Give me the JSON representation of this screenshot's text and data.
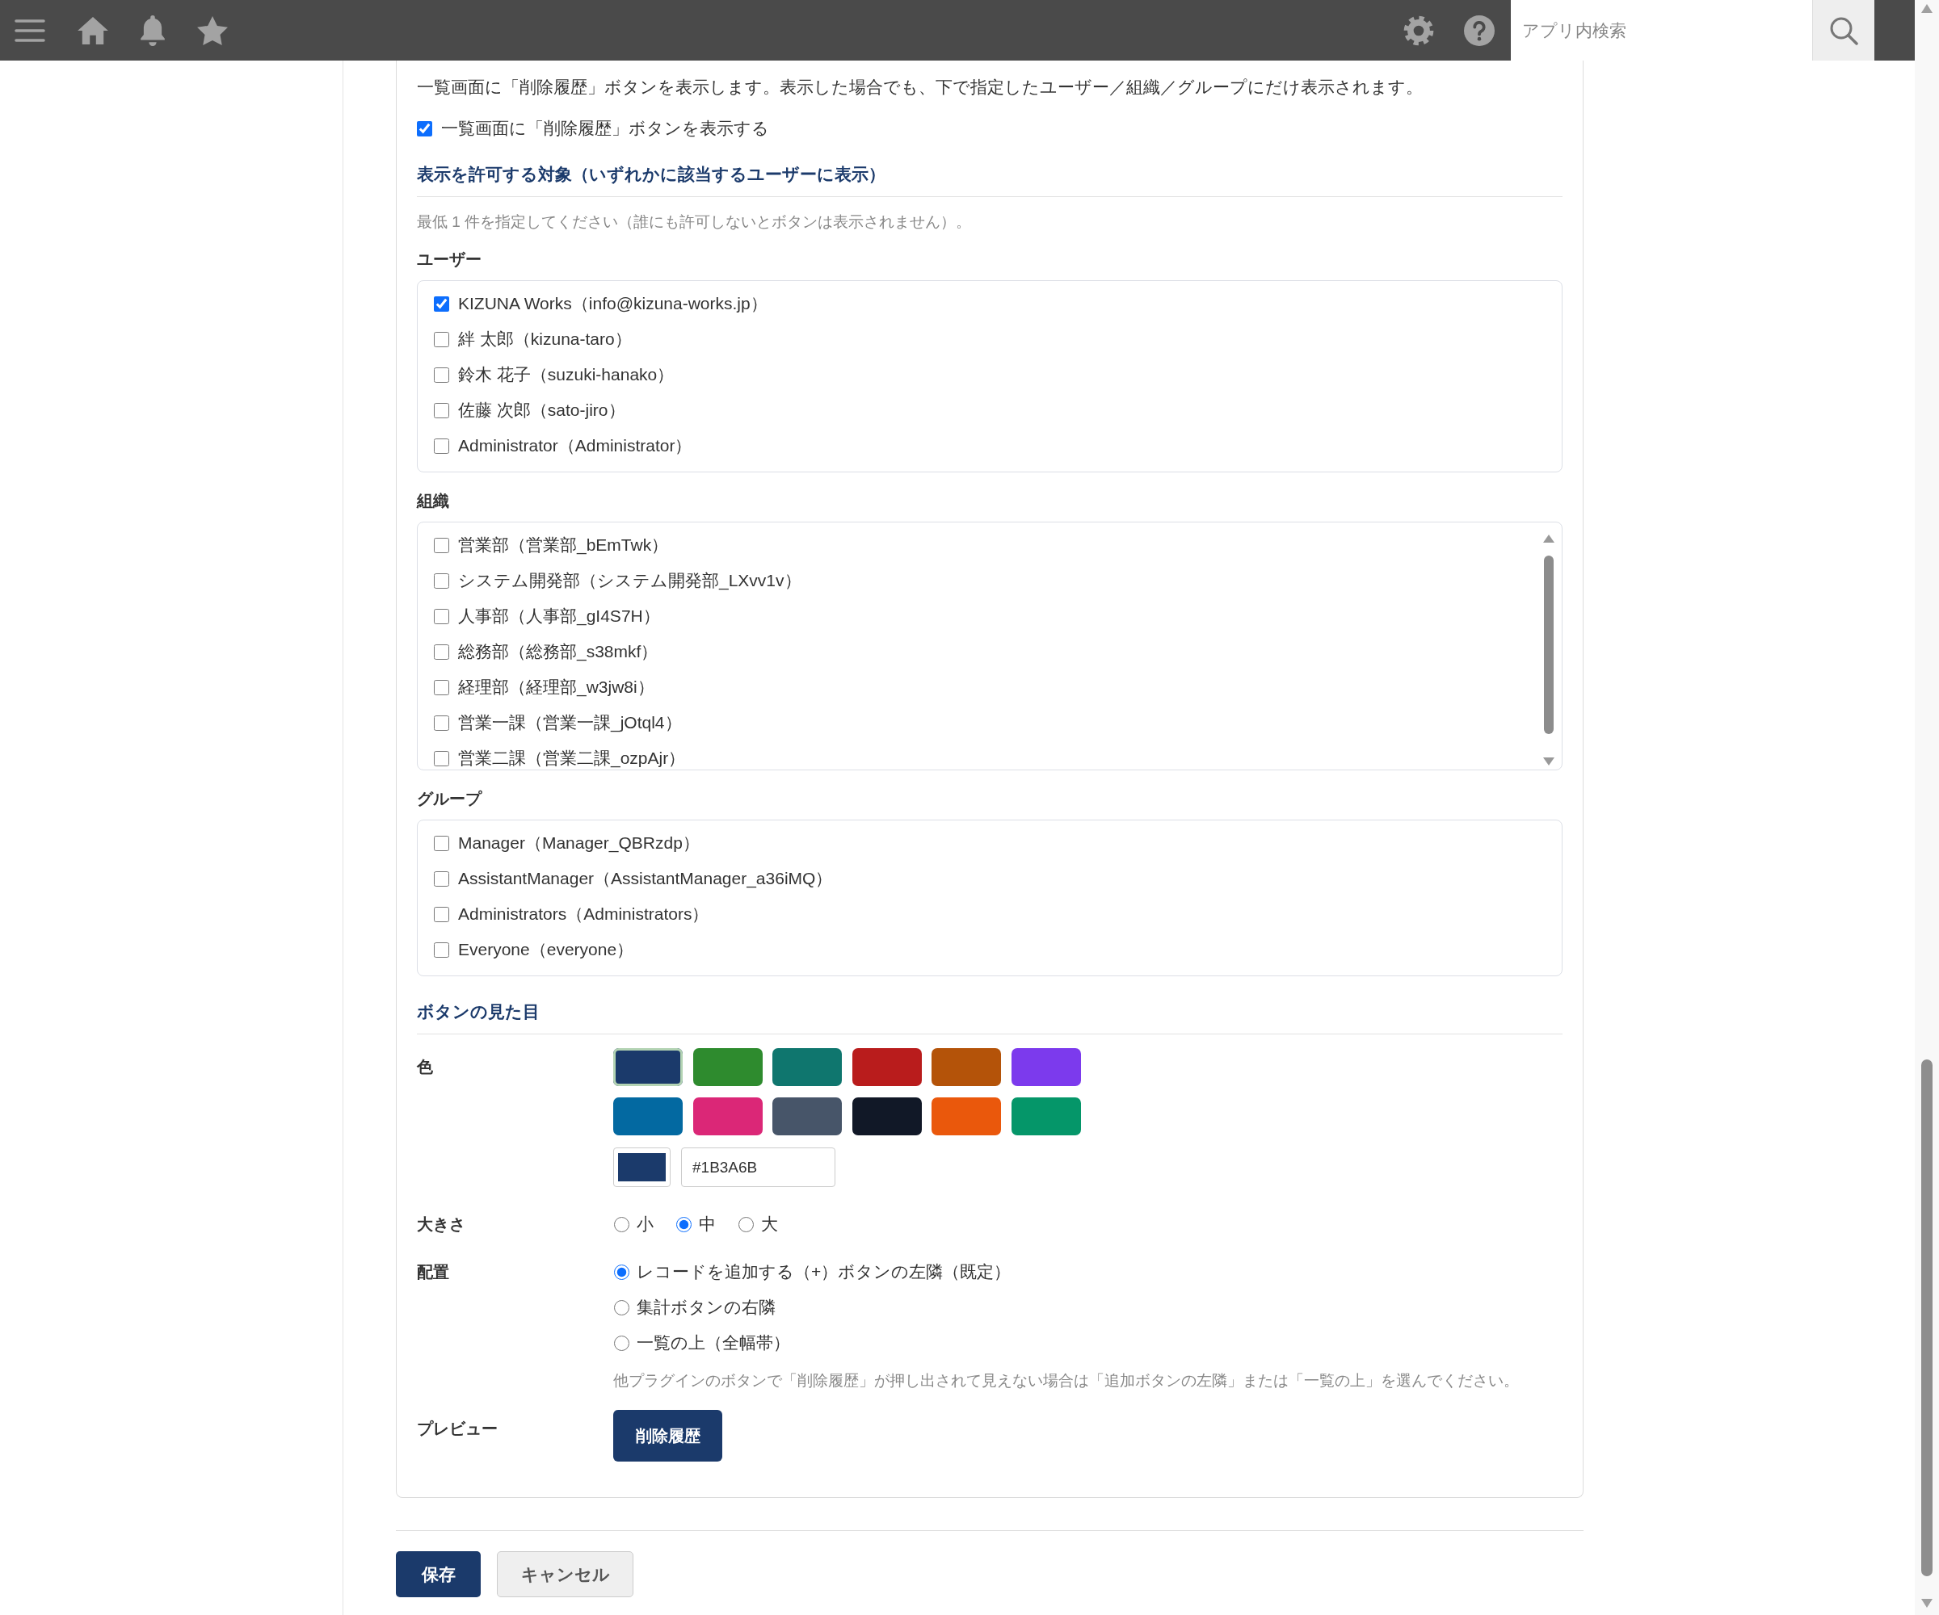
{
  "top_bar": {
    "search": {
      "placeholder": "アプリ内検索"
    }
  },
  "settings": {
    "description": "一覧画面に「削除履歴」ボタンを表示します。表示した場合でも、下で指定したユーザー／組織／グループにだけ表示されます。",
    "show_button": {
      "label": "一覧画面に「削除履歴」ボタンを表示する",
      "checked": true
    },
    "permissions": {
      "title": "表示を許可する対象（いずれかに該当するユーザーに表示）",
      "hint": "最低 1 件を指定してください（誰にも許可しないとボタンは表示されません）。",
      "lists": [
        {
          "label": "ユーザー",
          "scrollable": false,
          "items": [
            {
              "label": "KIZUNA Works（info@kizuna-works.jp）",
              "checked": true
            },
            {
              "label": "絆 太郎（kizuna-taro）",
              "checked": false
            },
            {
              "label": "鈴木 花子（suzuki-hanako）",
              "checked": false
            },
            {
              "label": "佐藤 次郎（sato-jiro）",
              "checked": false
            },
            {
              "label": "Administrator（Administrator）",
              "checked": false
            }
          ]
        },
        {
          "label": "組織",
          "scrollable": true,
          "items": [
            {
              "label": "営業部（営業部_bEmTwk）",
              "checked": false
            },
            {
              "label": "システム開発部（システム開発部_LXvv1v）",
              "checked": false
            },
            {
              "label": "人事部（人事部_gI4S7H）",
              "checked": false
            },
            {
              "label": "総務部（総務部_s38mkf）",
              "checked": false
            },
            {
              "label": "経理部（経理部_w3jw8i）",
              "checked": false
            },
            {
              "label": "営業一課（営業一課_jOtql4）",
              "checked": false
            },
            {
              "label": "営業二課（営業二課_ozpAjr）",
              "checked": false
            }
          ]
        },
        {
          "label": "グループ",
          "scrollable": false,
          "items": [
            {
              "label": "Manager（Manager_QBRzdp）",
              "checked": false
            },
            {
              "label": "AssistantManager（AssistantManager_a36iMQ）",
              "checked": false
            },
            {
              "label": "Administrators（Administrators）",
              "checked": false
            },
            {
              "label": "Everyone（everyone）",
              "checked": false
            }
          ]
        }
      ]
    },
    "appearance": {
      "title": "ボタンの見た目",
      "color": {
        "label": "色",
        "swatches": [
          {
            "color": "#1b3a6b",
            "selected": true
          },
          {
            "color": "#2e8b2e",
            "selected": false
          },
          {
            "color": "#0f766e",
            "selected": false
          },
          {
            "color": "#b91c1c",
            "selected": false
          },
          {
            "color": "#b45309",
            "selected": false
          },
          {
            "color": "#7c3aed",
            "selected": false
          },
          {
            "color": "#0369a1",
            "selected": false
          },
          {
            "color": "#db2777",
            "selected": false
          },
          {
            "color": "#475569",
            "selected": false
          },
          {
            "color": "#111827",
            "selected": false
          },
          {
            "color": "#ea580c",
            "selected": false
          },
          {
            "color": "#059669",
            "selected": false
          }
        ],
        "custom": {
          "color": "#1b3a6b",
          "value": "#1B3A6B"
        }
      },
      "size": {
        "label": "大きさ",
        "options": [
          {
            "label": "小",
            "selected": false
          },
          {
            "label": "中",
            "selected": true
          },
          {
            "label": "大",
            "selected": false
          }
        ]
      },
      "placement": {
        "label": "配置",
        "options": [
          {
            "label": "レコードを追加する（+）ボタンの左隣（既定）",
            "selected": true
          },
          {
            "label": "集計ボタンの右隣",
            "selected": false
          },
          {
            "label": "一覧の上（全幅帯）",
            "selected": false
          }
        ],
        "note": "他プラグインのボタンで「削除履歴」が押し出されて見えない場合は「追加ボタンの左隣」または「一覧の上」を選んでください。"
      },
      "preview": {
        "label": "プレビュー",
        "button": "削除履歴"
      }
    }
  },
  "footer": {
    "buttons": [
      {
        "label": "保存",
        "kind": "primary"
      },
      {
        "label": "キャンセル",
        "kind": "secondary"
      }
    ]
  }
}
